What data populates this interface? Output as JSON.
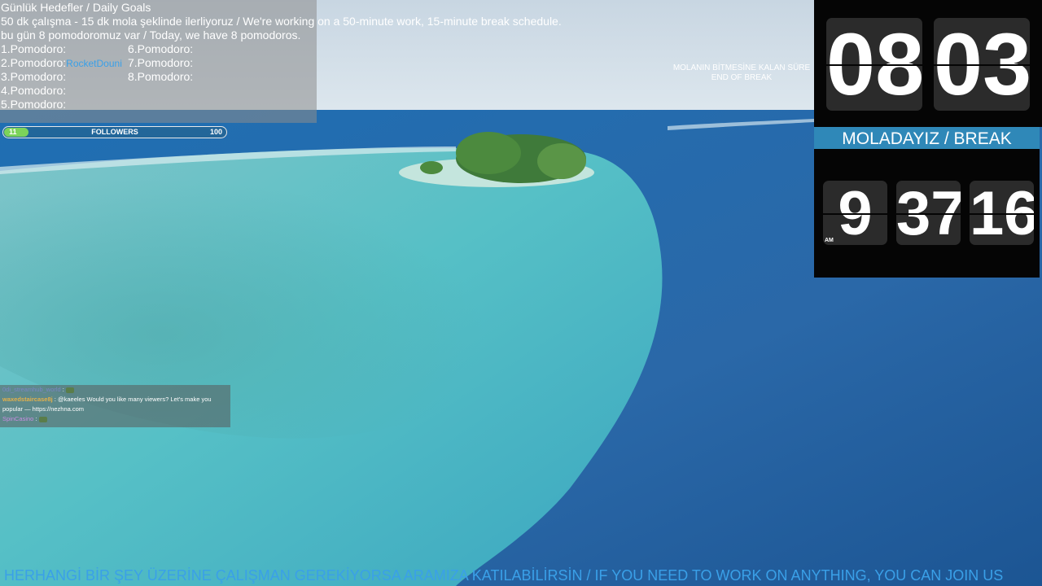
{
  "goals": {
    "title": "Günlük Hedefler / Daily Goals",
    "schedule": "50 dk çalışma - 15 dk mola şeklinde ilerliyoruz / We're working on a 50-minute work, 15-minute break schedule.",
    "count": "bu gün 8 pomodoromuz var / Today, we have 8 pomodoros.",
    "pomodoros": [
      {
        "label": "1.Pomodoro:",
        "user": ""
      },
      {
        "label": "2.Pomodoro:",
        "user": "RocketDouni"
      },
      {
        "label": "3.Pomodoro:",
        "user": ""
      },
      {
        "label": "4.Pomodoro:",
        "user": ""
      },
      {
        "label": "5.Pomodoro:",
        "user": ""
      },
      {
        "label": "6.Pomodoro:",
        "user": ""
      },
      {
        "label": "7.Pomodoro:",
        "user": ""
      },
      {
        "label": "8.Pomodoro:",
        "user": ""
      }
    ]
  },
  "followers": {
    "current": "11",
    "label": "FOLLOWERS",
    "goal": "100",
    "progress": 0.11,
    "fill_color": "#7cd35a"
  },
  "break_label": {
    "line1": "MOLANIN BİTMESİNE KALAN SÜRE",
    "line2": "END OF BREAK"
  },
  "countdown": {
    "minutes": "08",
    "seconds": "03"
  },
  "status_banner": "MOLADAYIZ / BREAK",
  "clock": {
    "hour": "9",
    "minute": "37",
    "second": "16",
    "ampm": "AM"
  },
  "chat": [
    {
      "user": "0di_streamhub_world",
      "sep": " : ",
      "text": "",
      "emote": "frog-emote"
    },
    {
      "user": "waxedstaircase8j",
      "sep": " : ",
      "text": "@kaeeles Would you like many viewers? Let's make you",
      "cont": "popular — https://nezhna.com"
    },
    {
      "user": "SpinCasino",
      "sep": " : ",
      "text": "",
      "emote": "frog-emote"
    }
  ],
  "ticker": "HERHANGİ BİR ŞEY ÜZERİNE ÇALIŞMAN GEREKİYORSA ARAMIZA KATILABİLİRSİN / IF YOU NEED TO WORK ON ANYTHING, YOU CAN JOIN US",
  "colors": {
    "banner": "#2f88b8",
    "ticker_text": "#3aa0e8",
    "accent_user": "#3aa0e8"
  }
}
